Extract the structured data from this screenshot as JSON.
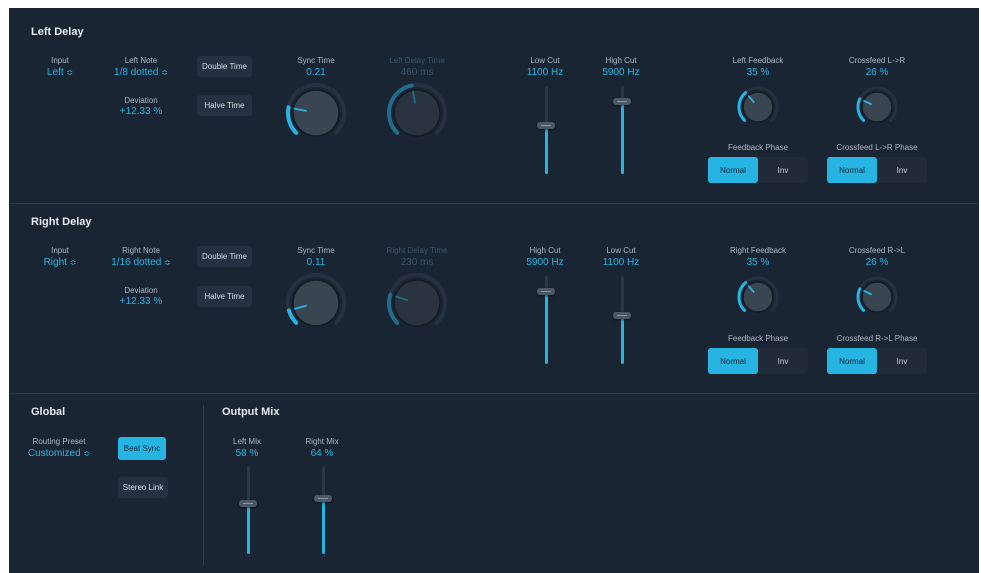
{
  "left_delay": {
    "title": "Left Delay",
    "input_label": "Input",
    "input_value": "Left",
    "note_label": "Left Note",
    "note_value": "1/8 dotted",
    "deviation_label": "Deviation",
    "deviation_value": "+12.33 %",
    "double_time": "Double Time",
    "halve_time": "Halve Time",
    "sync_time_label": "Sync Time",
    "sync_time_value": "0.21",
    "delay_time_label": "Left Delay Time",
    "delay_time_value": "460 ms",
    "cut1_label": "Low Cut",
    "cut1_value": "1100 Hz",
    "cut2_label": "High Cut",
    "cut2_value": "5900 Hz",
    "feedback_label": "Left Feedback",
    "feedback_value": "35 %",
    "crossfeed_label": "Crossfeed L->R",
    "crossfeed_value": "26 %",
    "feedback_phase_label": "Feedback Phase",
    "crossfeed_phase_label": "Crossfeed L->R Phase",
    "normal": "Normal",
    "inv": "Inv"
  },
  "right_delay": {
    "title": "Right Delay",
    "input_label": "Input",
    "input_value": "Right",
    "note_label": "Right Note",
    "note_value": "1/16 dotted",
    "deviation_label": "Deviation",
    "deviation_value": "+12.33 %",
    "double_time": "Double Time",
    "halve_time": "Halve Time",
    "sync_time_label": "Sync Time",
    "sync_time_value": "0.11",
    "delay_time_label": "Right Delay Time",
    "delay_time_value": "230 ms",
    "cut1_label": "High Cut",
    "cut1_value": "5900 Hz",
    "cut2_label": "Low Cut",
    "cut2_value": "1100 Hz",
    "feedback_label": "Right Feedback",
    "feedback_value": "35 %",
    "crossfeed_label": "Crossfeed R->L",
    "crossfeed_value": "26 %",
    "feedback_phase_label": "Feedback Phase",
    "crossfeed_phase_label": "Crossfeed R->L Phase",
    "normal": "Normal",
    "inv": "Inv"
  },
  "global": {
    "title": "Global",
    "routing_label": "Routing Preset",
    "routing_value": "Customized",
    "beat_sync": "Beat Sync",
    "stereo_link": "Stereo Link"
  },
  "output_mix": {
    "title": "Output Mix",
    "left_label": "Left Mix",
    "left_value": "58 %",
    "right_label": "Right Mix",
    "right_value": "64 %"
  },
  "levels": {
    "left_sync_time": 0.21,
    "left_delay_time": 0.46,
    "right_sync_time": 0.11,
    "right_delay_time": 0.23,
    "left_feedback": 0.35,
    "left_crossfeed": 0.26,
    "right_feedback": 0.35,
    "right_crossfeed": 0.26,
    "left_low_cut": 0.55,
    "left_high_cut": 0.85,
    "right_high_cut": 0.85,
    "right_low_cut": 0.55,
    "left_mix": 0.58,
    "right_mix": 0.64
  },
  "colors": {
    "accent": "#26b4e3",
    "panel": "#1a2533",
    "text": "#e6ebf0"
  }
}
